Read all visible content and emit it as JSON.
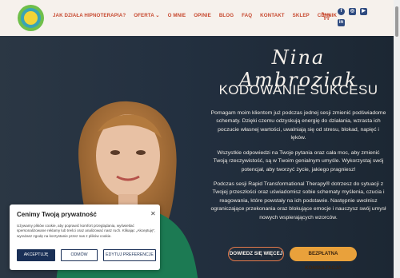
{
  "nav": {
    "items": [
      {
        "label": "JAK DZIAŁA HIPNOTERAPIA?"
      },
      {
        "label": "OFERTA ⌄"
      },
      {
        "label": "O MNIE"
      },
      {
        "label": "OPINIE"
      },
      {
        "label": "BLOG"
      },
      {
        "label": "FAQ"
      },
      {
        "label": "KONTAKT"
      },
      {
        "label": "SKLEP"
      },
      {
        "label": "CENNIK"
      }
    ],
    "cart_icon": "cart-icon",
    "social": [
      {
        "icon": "facebook-icon",
        "glyph": "f"
      },
      {
        "icon": "instagram-icon",
        "glyph": "◎"
      },
      {
        "icon": "youtube-icon",
        "glyph": "▶"
      },
      {
        "icon": "linkedin-icon",
        "glyph": "in"
      }
    ]
  },
  "hero": {
    "signature": "Nina Ambroziak",
    "title": "KODOWANIE SUKCESU",
    "paragraph1": "Pomagam moim klientom już podczas jednej sesji zmienić podświadome schematy. Dzięki czemu odzyskują energię do działania, wzrasta ich poczucie własnej wartości, uwalniają się od stresu, blokad, napięć i lęków.",
    "paragraph2": "Wszystkie odpowiedzi na Twoje pytania oraz cała moc, aby zmienić Twoją rzeczywistość, są w Twoim genialnym umyśle. Wykorzystaj swój potencjał, aby tworzyć życie, jakiego pragniesz!",
    "paragraph3": "Podczas sesji Rapid Transformational Therapy® dotrzesz do sytuacji z Twojej przeszłości oraz uświadomisz sobie schematy myślenia, czucia i reagowania, które powstały na ich podstawie. Następnie uwolnisz ograniczające przekonania oraz blokujące emocje i nauczysz swój umysł nowych wspierających wzorców.",
    "button_more": "DOWIEDZ SIĘ WIĘCEJ",
    "button_consult": "BEZPŁATNA KONSULTACJA"
  },
  "cookie": {
    "title": "Cenimy Twoją prywatność",
    "close": "✕",
    "text": "Używamy plików cookie, aby poprawić komfort przeglądania, wyświetlać spersonalizowane reklamy lub treści oraz analizować nasz ruch. Klikając „Akceptuję”, wyrażasz zgodę na korzystanie przez nas z plików cookie.",
    "accept": "AKCEPTUJĘ",
    "reject": "ODMÓW",
    "prefs": "EDYTUJ PREFERENCJE"
  },
  "colors": {
    "nav_text": "#c7492f",
    "header_bg": "#f6f1ec",
    "accent_orange": "#e9a13b",
    "cookie_primary": "#1a3057"
  }
}
